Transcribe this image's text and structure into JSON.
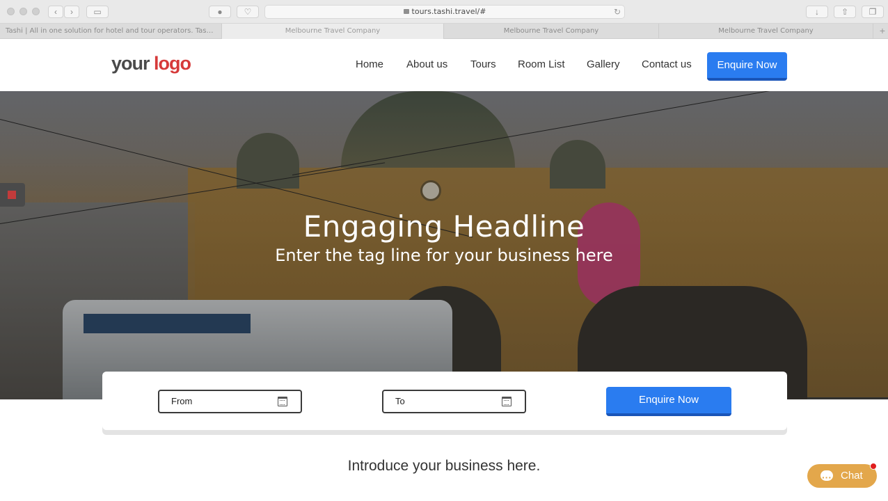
{
  "browser": {
    "url": "tours.tashi.travel/#",
    "tabs": [
      {
        "label": "Tashi | All in one solution for hotel and tour operators. Tashi gr..."
      },
      {
        "label": "Melbourne Travel Company"
      },
      {
        "label": "Melbourne Travel Company"
      },
      {
        "label": "Melbourne Travel Company"
      }
    ]
  },
  "header": {
    "logo_main": "your ",
    "logo_accent": "logo",
    "nav": [
      "Home",
      "About us",
      "Tours",
      "Room List",
      "Gallery",
      "Contact us"
    ],
    "enquire_label": "Enquire Now"
  },
  "hero": {
    "headline": "Engaging Headline",
    "tagline": "Enter the tag line for your business here"
  },
  "booking": {
    "from_placeholder": "From",
    "to_placeholder": "To",
    "enquire_label": "Enquire Now"
  },
  "intro": "Introduce your business here.",
  "chat": {
    "label": "Chat"
  },
  "colors": {
    "accent_blue": "#2a7cf0",
    "logo_red": "#d63a3a",
    "chat_orange": "#e3a74b"
  },
  "icons": [
    "back-icon",
    "forward-icon",
    "sidebar-icon",
    "grammarly-icon",
    "pocket-icon",
    "lock-icon",
    "reload-icon",
    "download-icon",
    "share-icon",
    "tabs-icon",
    "calendar-icon",
    "chat-bubble-icon"
  ]
}
